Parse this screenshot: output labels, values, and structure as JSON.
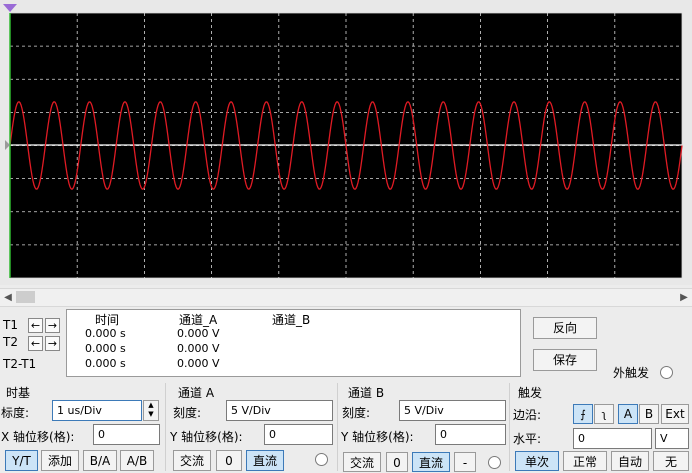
{
  "colors": {
    "screen_bg": "#000000",
    "grid": "#d9d9d9",
    "trace_a": "#e01b24",
    "trace_b": "#ffffff",
    "cursor1": "#2fb82f"
  },
  "signal": {
    "cycles_visible": 19,
    "amplitude_divs": 0.6
  },
  "cursors": {
    "t1_label": "T1",
    "t2_label": "T2",
    "diff_label": "T2-T1",
    "left_arrow": "←",
    "right_arrow": "→"
  },
  "readout": {
    "col_time": "时间",
    "col_a": "通道_A",
    "col_b": "通道_B",
    "rows": [
      {
        "time": "0.000 s",
        "a": "0.000 V"
      },
      {
        "time": "0.000 s",
        "a": "0.000 V"
      },
      {
        "time": "0.000 s",
        "a": "0.000 V"
      }
    ]
  },
  "actions": {
    "reverse": "反向",
    "save": "保存",
    "ext_trigger": "外触发"
  },
  "timebase": {
    "title": "时基",
    "scale_label": "标度:",
    "scale_value": "1 us/Div",
    "xpos_label": "X 轴位移(格):",
    "xpos_value": "0",
    "modes": [
      "Y/T",
      "添加",
      "B/A",
      "A/B"
    ]
  },
  "channel_a": {
    "title": "通道 A",
    "scale_label": "刻度:",
    "scale_value": "5  V/Div",
    "ypos_label": "Y 轴位移(格):",
    "ypos_value": "0",
    "coupling": [
      "交流",
      "0",
      "直流"
    ]
  },
  "channel_b": {
    "title": "通道 B",
    "scale_label": "刻度:",
    "scale_value": "5  V/Div",
    "ypos_label": "Y 轴位移(格):",
    "ypos_value": "0",
    "coupling": [
      "交流",
      "0",
      "直流",
      "-"
    ]
  },
  "trigger": {
    "title": "触发",
    "edge_label": "边沿:",
    "edge_rise": "⨍",
    "edge_fall": "ʅ",
    "sources": [
      "A",
      "B",
      "Ext"
    ],
    "level_label": "水平:",
    "level_value": "0",
    "level_unit": "V",
    "modes": [
      "单次",
      "正常",
      "自动",
      "无"
    ]
  },
  "scroll": {
    "left": "◀",
    "right": "▶"
  }
}
